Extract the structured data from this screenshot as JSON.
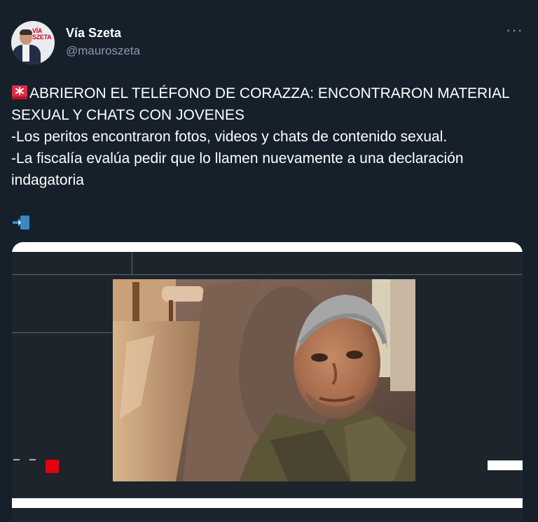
{
  "tweet": {
    "author_name": "Vía Szeta",
    "handle": "@mauroszeta",
    "more_label": "···",
    "avatar_logo_line1": "VÍA",
    "avatar_logo_line2": "SZETA",
    "lines": [
      "ABRIERON EL TELÉFONO DE CORAZZA: ENCONTRARON MATERIAL",
      "SEXUAL Y CHATS CON JOVENES",
      "-Los peritos encontraron fotos, videos y chats de contenido sexual.",
      "-La fiscalía evalúa pedir que lo llamen nuevamente a una declaración",
      "indagatoria"
    ],
    "icons": {
      "siren": "police-light-icon",
      "arrow": "arrow-into-box-icon",
      "more": "more-options-icon"
    }
  },
  "colors": {
    "background": "#15202b",
    "secondary_text": "#8899a6",
    "accent_red": "#e3000f"
  }
}
